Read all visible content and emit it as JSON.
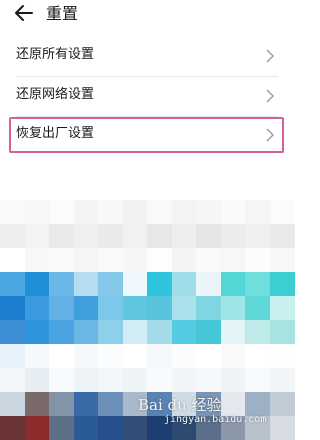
{
  "header": {
    "title": "重置",
    "back_icon": "arrow-left-icon"
  },
  "menu": {
    "items": [
      {
        "label": "还原所有设置",
        "icon": "chevron-right-icon",
        "highlighted": false
      },
      {
        "label": "还原网络设置",
        "icon": "chevron-right-icon",
        "highlighted": false
      },
      {
        "label": "恢复出厂设置",
        "icon": "chevron-right-icon",
        "highlighted": true
      }
    ]
  },
  "colors": {
    "highlight_border": "#d6619a",
    "text": "#1a1a1a",
    "divider": "#e8e8e8"
  },
  "watermark": {
    "logo": "Bai du 经验",
    "url": "jingyan.baidu.com"
  }
}
